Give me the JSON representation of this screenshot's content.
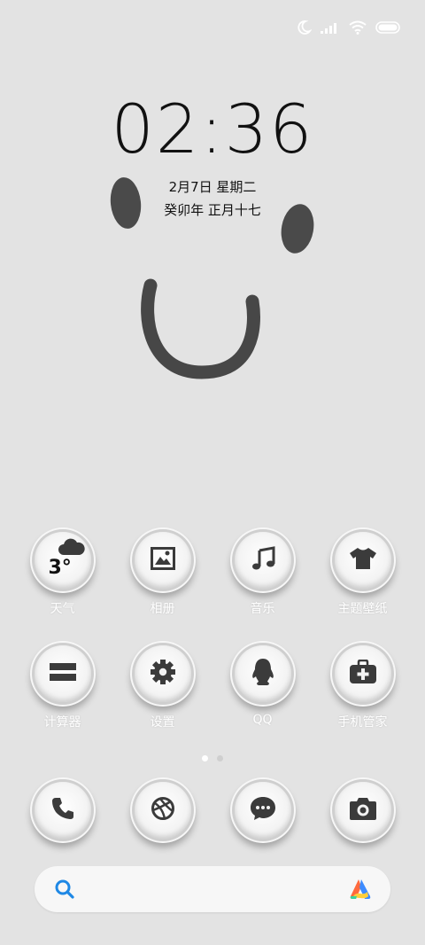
{
  "status_bar": {
    "icons": [
      "moon-icon",
      "signal-icon",
      "wifi-icon",
      "battery-icon"
    ]
  },
  "lockclock": {
    "time": "02:36",
    "date": "2月7日 星期二",
    "lunar": "癸卯年 正月十七"
  },
  "apps_row1": [
    {
      "label": "天气",
      "icon": "weather-cloud-icon",
      "temp": "3°"
    },
    {
      "label": "相册",
      "icon": "gallery-icon"
    },
    {
      "label": "音乐",
      "icon": "music-note-icon"
    },
    {
      "label": "主题壁纸",
      "icon": "tshirt-icon"
    }
  ],
  "apps_row2": [
    {
      "label": "计算器",
      "icon": "calculator-icon"
    },
    {
      "label": "设置",
      "icon": "gear-icon"
    },
    {
      "label": "QQ",
      "icon": "penguin-icon"
    },
    {
      "label": "手机管家",
      "icon": "first-aid-icon"
    }
  ],
  "dock": [
    {
      "icon": "phone-icon"
    },
    {
      "icon": "browser-icon"
    },
    {
      "icon": "message-icon"
    },
    {
      "icon": "camera-icon"
    }
  ],
  "pages": {
    "count": 2,
    "active": 1
  },
  "search": {
    "placeholder": ""
  },
  "colors": {
    "background": "#e3e3e3",
    "icon_fill": "#3b3b3b",
    "label": "#ffffff",
    "search_accent": "#1e88e5"
  }
}
